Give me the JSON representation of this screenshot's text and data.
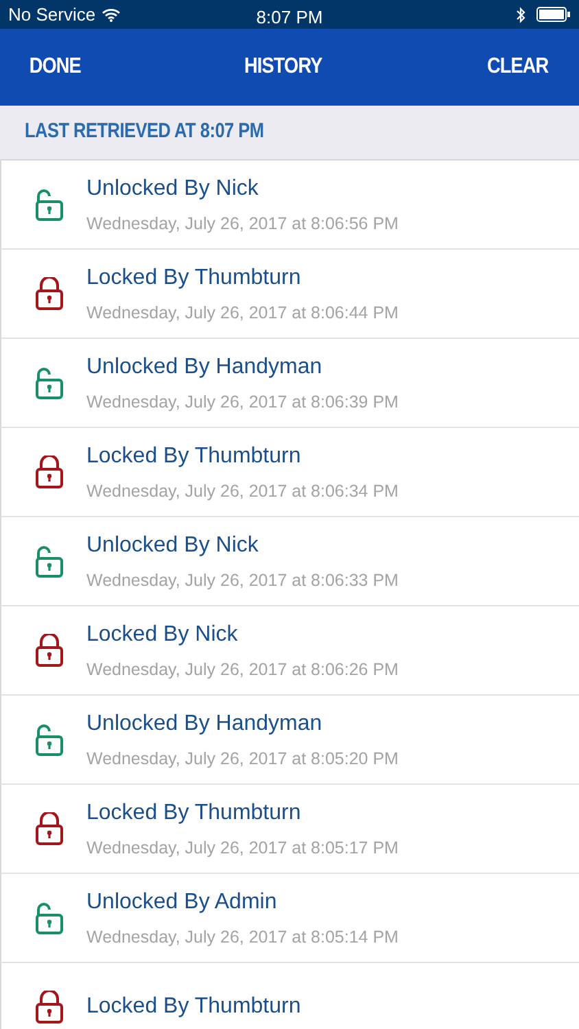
{
  "status_bar": {
    "carrier": "No Service",
    "time": "8:07 PM"
  },
  "nav_bar": {
    "left": "DONE",
    "title": "HISTORY",
    "right": "CLEAR"
  },
  "section_header": "LAST RETRIEVED AT 8:07 PM",
  "events": [
    {
      "kind": "unlocked",
      "title": "Unlocked By Nick",
      "time": "Wednesday, July 26, 2017 at 8:06:56 PM"
    },
    {
      "kind": "locked",
      "title": "Locked By Thumbturn",
      "time": "Wednesday, July 26, 2017 at 8:06:44 PM"
    },
    {
      "kind": "unlocked",
      "title": "Unlocked By Handyman",
      "time": "Wednesday, July 26, 2017 at 8:06:39 PM"
    },
    {
      "kind": "locked",
      "title": "Locked By Thumbturn",
      "time": "Wednesday, July 26, 2017 at 8:06:34 PM"
    },
    {
      "kind": "unlocked",
      "title": "Unlocked By Nick",
      "time": "Wednesday, July 26, 2017 at 8:06:33 PM"
    },
    {
      "kind": "locked",
      "title": "Locked By Nick",
      "time": "Wednesday, July 26, 2017 at 8:06:26 PM"
    },
    {
      "kind": "unlocked",
      "title": "Unlocked By Handyman",
      "time": "Wednesday, July 26, 2017 at 8:05:20 PM"
    },
    {
      "kind": "locked",
      "title": "Locked By Thumbturn",
      "time": "Wednesday, July 26, 2017 at 8:05:17 PM"
    },
    {
      "kind": "unlocked",
      "title": "Unlocked By Admin",
      "time": "Wednesday, July 26, 2017 at 8:05:14 PM"
    },
    {
      "kind": "locked",
      "title": "Locked By Thumbturn"
    }
  ]
}
